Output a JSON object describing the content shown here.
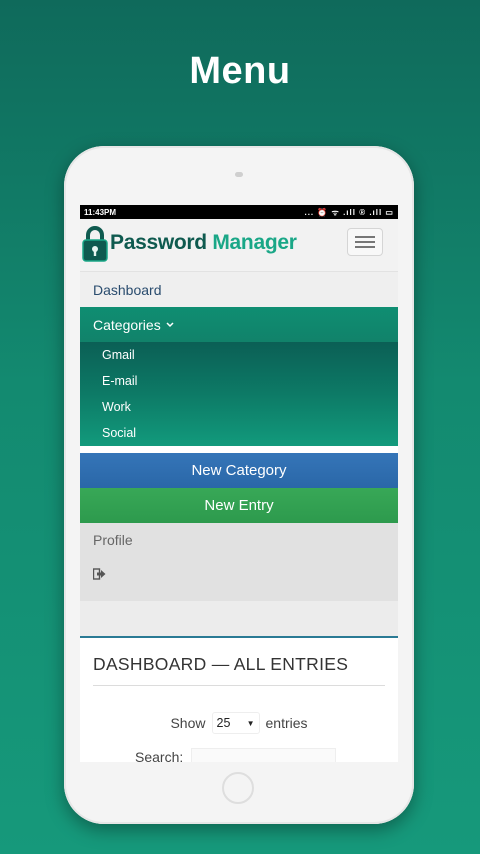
{
  "heading": "Menu",
  "status_bar": {
    "time": "11:43PM",
    "icons_text": "... ⏰ ᯤ .ıll ® .ıll ▭"
  },
  "logo": {
    "word1": "Password",
    "word2": "Manager"
  },
  "nav": {
    "dashboard": "Dashboard",
    "categories": "Categories",
    "category_items": [
      "Gmail",
      "E-mail",
      "Work",
      "Social"
    ],
    "new_category": "New Category",
    "new_entry": "New Entry",
    "profile": "Profile"
  },
  "content": {
    "title": "DASHBOARD — ALL ENTRIES",
    "show_label": "Show",
    "entries_value": "25",
    "entries_label": "entries",
    "search_label": "Search:"
  },
  "colors": {
    "background": "#138a70",
    "logo_dark": "#0f5a4f",
    "logo_light": "#1aa787",
    "new_category_button": "#2f6fb0",
    "new_entry_button": "#33a152"
  },
  "icons": [
    "lock-icon",
    "hamburger-icon",
    "chevron-down-icon",
    "logout-icon",
    "select-arrow-icon"
  ]
}
